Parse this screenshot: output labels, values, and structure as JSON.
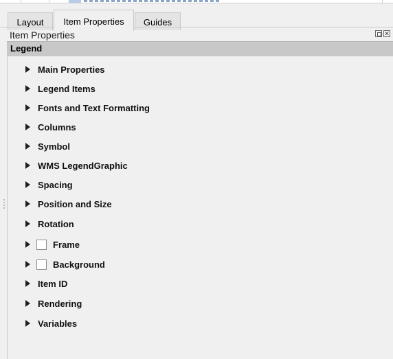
{
  "tabs": [
    {
      "label": "Layout",
      "active": false
    },
    {
      "label": "Item Properties",
      "active": true
    },
    {
      "label": "Guides",
      "active": false
    }
  ],
  "panel": {
    "title": "Item Properties",
    "section": "Legend"
  },
  "groups": [
    {
      "label": "Main Properties",
      "checkbox": false,
      "expanded": false
    },
    {
      "label": "Legend Items",
      "checkbox": false,
      "expanded": false
    },
    {
      "label": "Fonts and Text Formatting",
      "checkbox": false,
      "expanded": false
    },
    {
      "label": "Columns",
      "checkbox": false,
      "expanded": false
    },
    {
      "label": "Symbol",
      "checkbox": false,
      "expanded": false
    },
    {
      "label": "WMS LegendGraphic",
      "checkbox": false,
      "expanded": false
    },
    {
      "label": "Spacing",
      "checkbox": false,
      "expanded": false
    },
    {
      "label": "Position and Size",
      "checkbox": false,
      "expanded": false
    },
    {
      "label": "Rotation",
      "checkbox": false,
      "expanded": false
    },
    {
      "label": "Frame",
      "checkbox": true,
      "checked": false,
      "expanded": false
    },
    {
      "label": "Background",
      "checkbox": true,
      "checked": false,
      "expanded": false
    },
    {
      "label": "Item ID",
      "checkbox": false,
      "expanded": false
    },
    {
      "label": "Rendering",
      "checkbox": false,
      "expanded": false
    },
    {
      "label": "Variables",
      "checkbox": false,
      "expanded": false
    }
  ]
}
